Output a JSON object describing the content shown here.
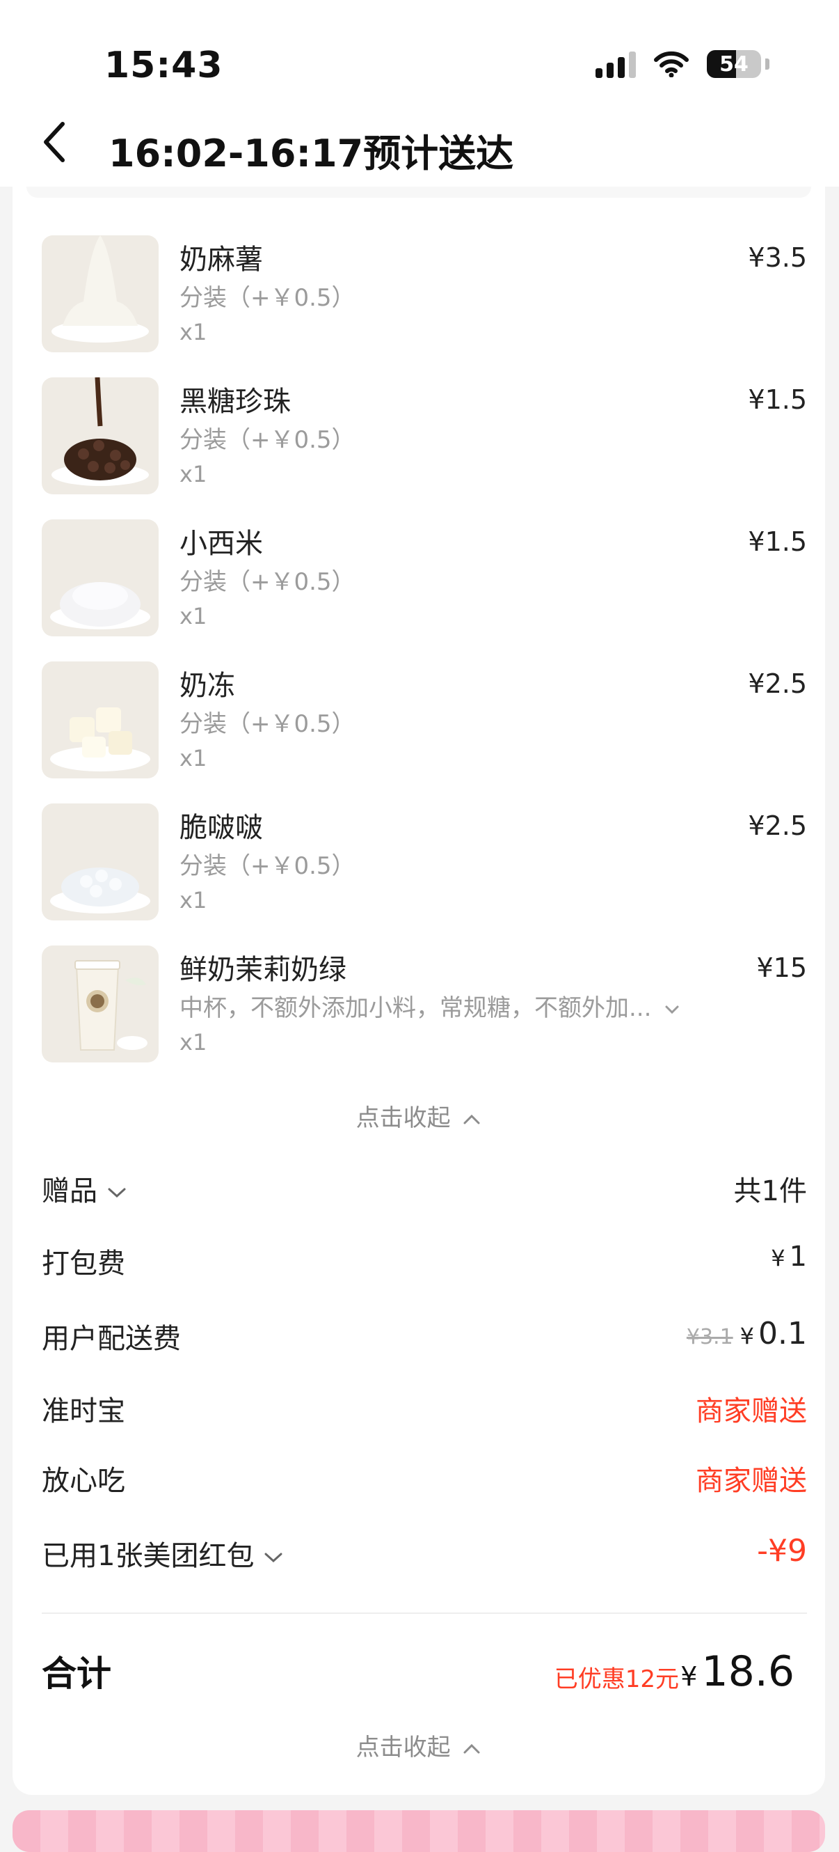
{
  "status_bar": {
    "time": "15:43",
    "battery": "54",
    "battery_level": 0.54
  },
  "header": {
    "title": "16:02-16:17预计送达"
  },
  "items": [
    {
      "name": "奶麻薯",
      "spec": "分装（+￥0.5）",
      "qty": "x1",
      "price": "¥3.5",
      "image": "milk-mochi"
    },
    {
      "name": "黑糖珍珠",
      "spec": "分装（+￥0.5）",
      "qty": "x1",
      "price": "¥1.5",
      "image": "brown-sugar-pearls"
    },
    {
      "name": "小西米",
      "spec": "分装（+￥0.5）",
      "qty": "x1",
      "price": "¥1.5",
      "image": "sago"
    },
    {
      "name": "奶冻",
      "spec": "分装（+￥0.5）",
      "qty": "x1",
      "price": "¥2.5",
      "image": "milk-jelly"
    },
    {
      "name": "脆啵啵",
      "spec": "分装（+￥0.5）",
      "qty": "x1",
      "price": "¥2.5",
      "image": "crystal-boba"
    },
    {
      "name": "鲜奶茉莉奶绿",
      "spec": "中杯，不额外添加小料，常规糖，不额外加...",
      "qty": "x1",
      "price": "¥15",
      "image": "jasmine-milk-tea-cup"
    }
  ],
  "collapse_label": "点击收起",
  "fees": {
    "gift": {
      "label": "赠品",
      "value": "共1件"
    },
    "packing": {
      "label": "打包费",
      "currency": "¥",
      "value": "1"
    },
    "delivery": {
      "label": "用户配送费",
      "original": "¥3.1",
      "currency": "¥",
      "value": "0.1"
    },
    "ontime": {
      "label": "准时宝",
      "value": "商家赠送"
    },
    "safe_eat": {
      "label": "放心吃",
      "value": "商家赠送"
    },
    "red_packet": {
      "label": "已用1张美团红包",
      "value": "-¥9"
    }
  },
  "total": {
    "label": "合计",
    "saved": "已优惠12元",
    "currency": "¥",
    "amount": "18.6"
  },
  "colors": {
    "accent_red": "#ff3d24",
    "muted": "#9b9b9b"
  }
}
